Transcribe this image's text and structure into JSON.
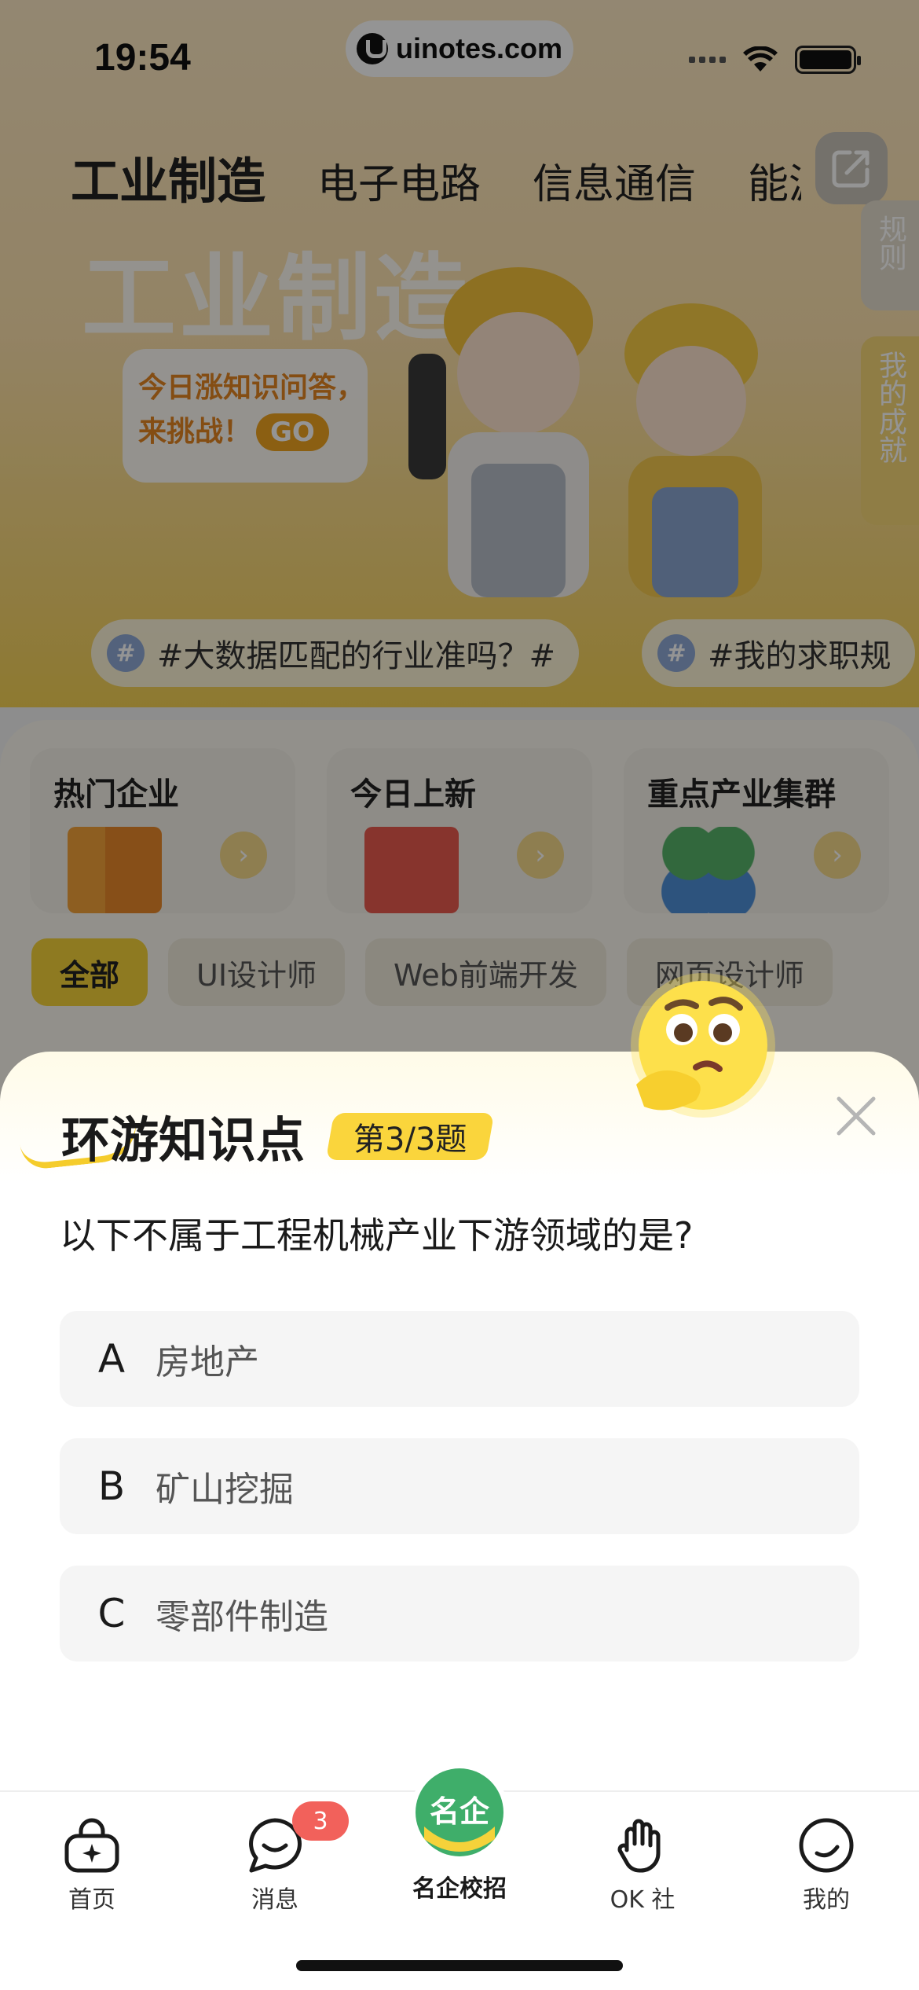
{
  "status_bar": {
    "time": "19:54",
    "url": "uinotes.com"
  },
  "category_tabs": [
    {
      "label": "工业制造",
      "active": true
    },
    {
      "label": "电子电路",
      "active": false
    },
    {
      "label": "信息通信",
      "active": false
    },
    {
      "label": "能源",
      "active": false
    }
  ],
  "side_tabs": {
    "rules": "规则",
    "achievements": "我的成就"
  },
  "hero": {
    "title": "工业制造",
    "quiz_prompt_line1": "今日涨知识问答，",
    "quiz_prompt_line2": "来挑战！",
    "go_label": "GO"
  },
  "hashtags": [
    {
      "icon": "#",
      "text": "#大数据匹配的行业准吗？#"
    },
    {
      "icon": "#",
      "text": "#我的求职规"
    }
  ],
  "feature_cards": [
    {
      "title": "热门企业",
      "icon": "building-icon"
    },
    {
      "title": "今日上新",
      "icon": "new-calendar-icon"
    },
    {
      "title": "重点产业集群",
      "icon": "cluster-icon"
    }
  ],
  "filter_chips": [
    {
      "label": "全部",
      "active": true
    },
    {
      "label": "UI设计师",
      "active": false
    },
    {
      "label": "Web前端开发",
      "active": false
    },
    {
      "label": "网页设计师",
      "active": false
    }
  ],
  "quiz": {
    "title": "环游知识点",
    "progress": "第3/3题",
    "question": "以下不属于工程机械产业下游领域的是?",
    "options": [
      {
        "letter": "A",
        "text": "房地产"
      },
      {
        "letter": "B",
        "text": "矿山挖掘"
      },
      {
        "letter": "C",
        "text": "零部件制造"
      }
    ]
  },
  "tabbar": {
    "home": "首页",
    "messages": "消息",
    "messages_badge": "3",
    "center": "名企校招",
    "center_logo": "名企",
    "ok": "OK 社",
    "me": "我的"
  },
  "colors": {
    "accent_yellow": "#F5D23A",
    "badge_red": "#F2615B",
    "center_green": "#3FAE6A"
  }
}
